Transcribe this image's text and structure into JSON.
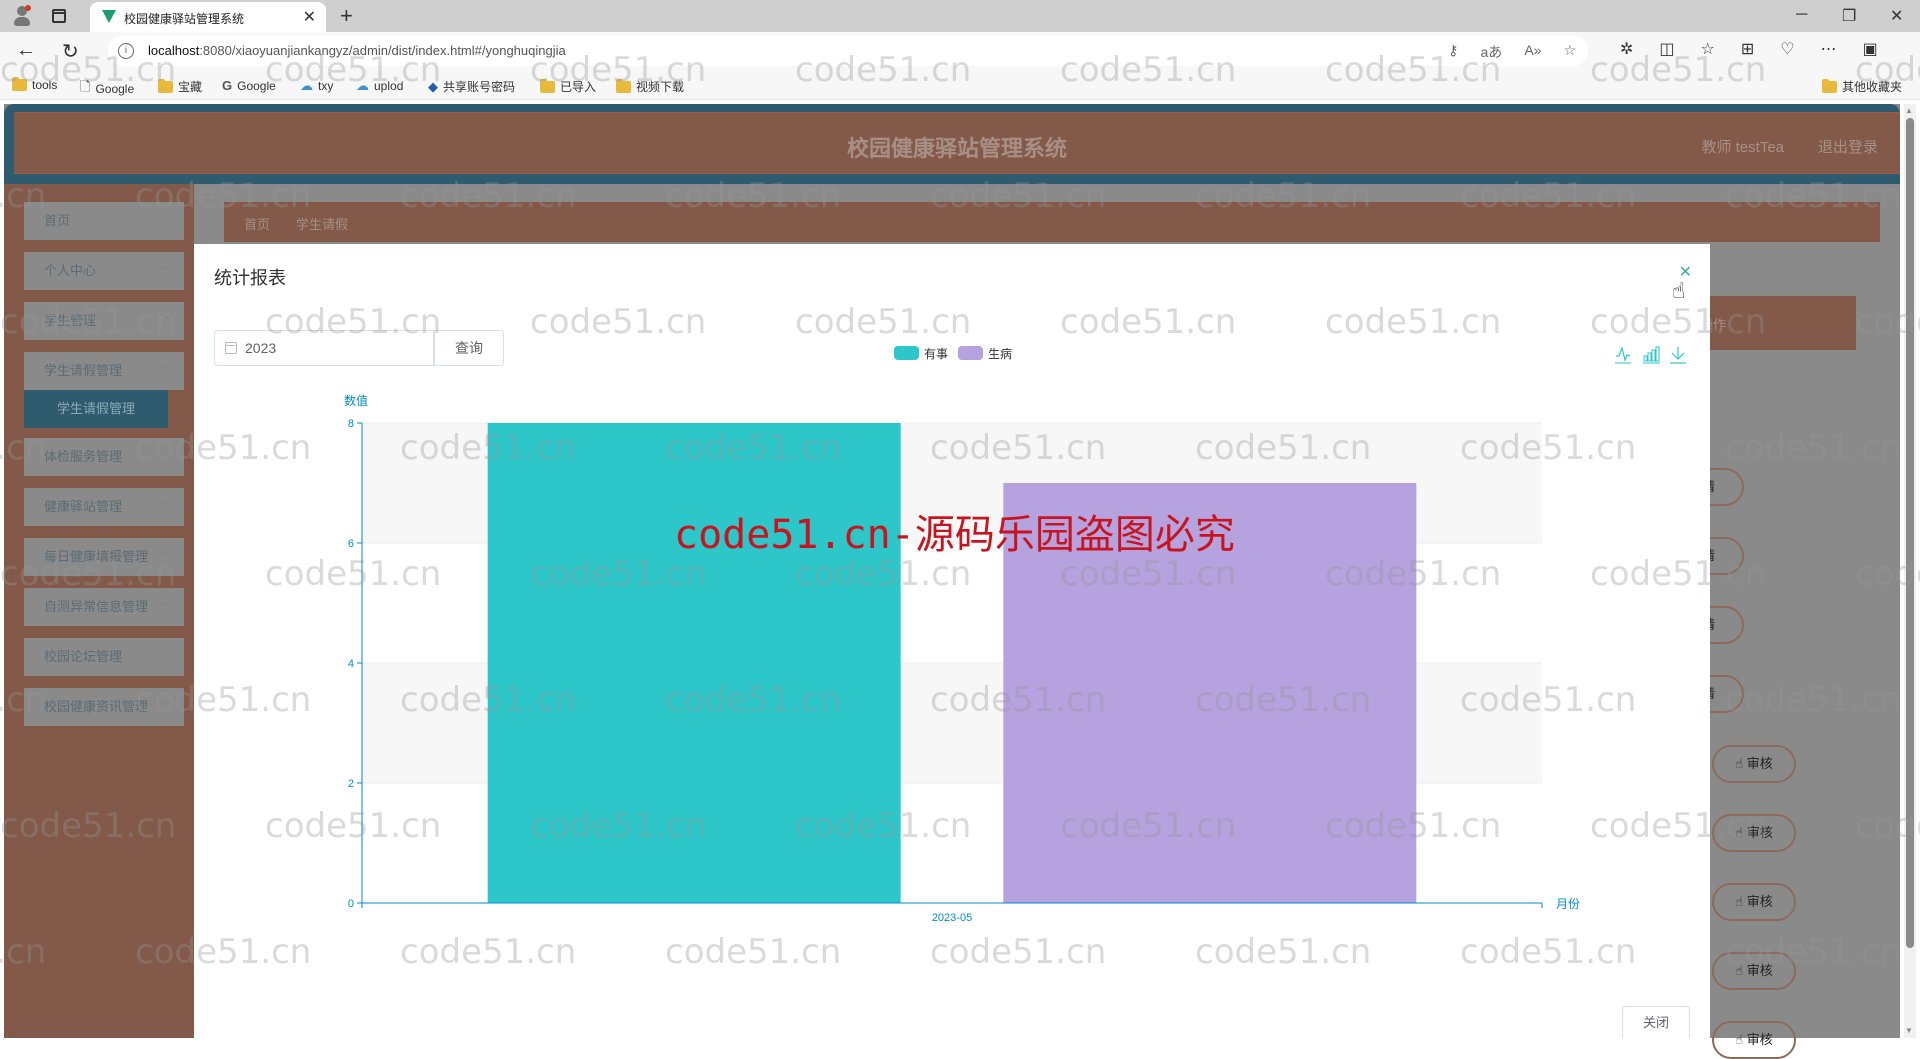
{
  "browser": {
    "tab_title": "校园健康驿站管理系统",
    "url_host": "localhost",
    "url_rest": ":8080/xiaoyuanjiankangyz/admin/dist/index.html#/yonghuqingjia",
    "bookmarks": [
      {
        "label": "tools",
        "icon": "folder-icon"
      },
      {
        "label": "Google",
        "icon": "page-icon"
      },
      {
        "label": "宝藏",
        "icon": "folder-icon"
      },
      {
        "label": "Google",
        "icon": "google-icon"
      },
      {
        "label": "txy",
        "icon": "cloud-icon"
      },
      {
        "label": "uplod",
        "icon": "upload-cloud-icon"
      },
      {
        "label": "共享账号密码",
        "icon": "share-icon"
      },
      {
        "label": "已导入",
        "icon": "folder-icon"
      },
      {
        "label": "视频下载",
        "icon": "folder-icon"
      }
    ],
    "other_bookmarks": "其他收藏夹"
  },
  "app": {
    "title": "校园健康驿站管理系统",
    "user": "教师 testTea",
    "logout": "退出登录",
    "sidebar": [
      {
        "label": "首页",
        "chevron": false
      },
      {
        "label": "个人中心",
        "chevron": true
      },
      {
        "label": "学生管理",
        "chevron": true
      },
      {
        "label": "学生请假管理",
        "chevron": true
      },
      {
        "label": "体检服务管理",
        "chevron": true
      },
      {
        "label": "健康驿站管理",
        "chevron": true
      },
      {
        "label": "每日健康填报管理",
        "chevron": true
      },
      {
        "label": "自测异常信息管理",
        "chevron": true
      },
      {
        "label": "校园论坛管理",
        "chevron": true
      },
      {
        "label": "校园健康资讯管理",
        "chevron": true
      }
    ],
    "sidebar_active_sub": "学生请假管理",
    "breadcrumb": [
      "首页",
      "学生请假"
    ],
    "table_head_action": "操作",
    "detail_label": "详情",
    "audit_label": "审核"
  },
  "modal": {
    "title": "统计报表",
    "year_value": "2023",
    "query_label": "查询",
    "close_label": "关闭"
  },
  "chart_data": {
    "type": "bar",
    "categories": [
      "2023-05"
    ],
    "series": [
      {
        "name": "有事",
        "values": [
          8
        ],
        "color": "#2ec7c9"
      },
      {
        "name": "生病",
        "values": [
          7
        ],
        "color": "#b6a2de"
      }
    ],
    "xlabel": "月份",
    "ylabel": "数值",
    "ylim": [
      0,
      8
    ],
    "yticks": [
      0,
      2,
      4,
      6,
      8
    ],
    "legend": "top-center",
    "grid": true,
    "toolbox": [
      "line-chart-icon",
      "bar-chart-icon",
      "download-icon"
    ],
    "axis_color": "#008acd"
  },
  "watermark": {
    "text": "code51.cn",
    "notice": "code51.cn-源码乐园盗图必究"
  }
}
